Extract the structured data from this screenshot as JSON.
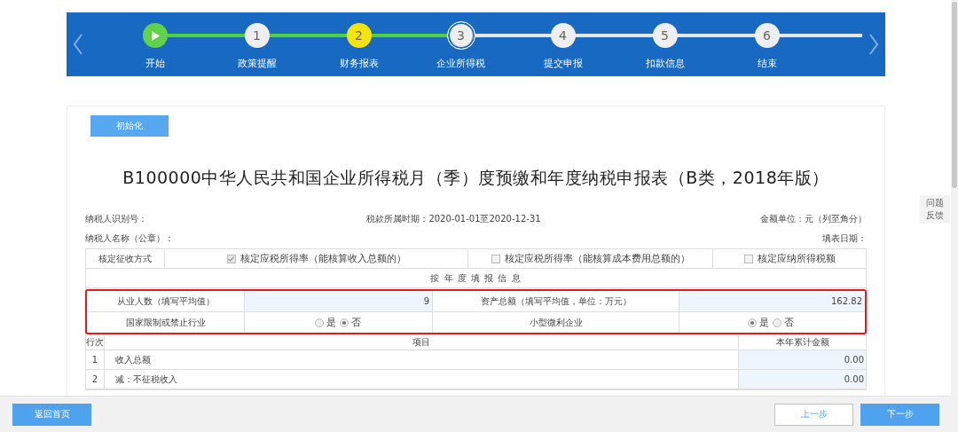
{
  "stepper": {
    "steps": [
      {
        "kind": "start",
        "label": "开始",
        "color": "#5fd24a",
        "current": false
      },
      {
        "kind": "number",
        "number": "1",
        "label": "政策提醒",
        "color": "#eeeeee",
        "reached": true,
        "current": false
      },
      {
        "kind": "number",
        "number": "2",
        "label": "财务报表",
        "color": "#f5e30f",
        "reached": true,
        "current": false
      },
      {
        "kind": "number",
        "number": "3",
        "label": "企业所得税",
        "color": "#eeeeee",
        "reached": true,
        "current": true
      },
      {
        "kind": "number",
        "number": "4",
        "label": "提交申报",
        "color": "#eeeeee",
        "reached": false,
        "current": false
      },
      {
        "kind": "number",
        "number": "5",
        "label": "扣款信息",
        "color": "#eeeeee",
        "reached": false,
        "current": false
      },
      {
        "kind": "number",
        "number": "6",
        "label": "结束",
        "color": "#eeeeee",
        "reached": false,
        "current": false
      }
    ]
  },
  "form": {
    "init_button": "初始化",
    "title": "B100000中华人民共和国企业所得税月（季）度预缴和年度纳税申报表（B类，2018年版）",
    "taxpayer_id_label": "纳税人识别号：",
    "period": "税款所属时期：2020-01-01至2020-12-31",
    "unit": "金额单位：元（列至角分）",
    "taxpayer_name_label": "纳税人名称（公章）：",
    "fill_date_label": "填表日期：",
    "method": {
      "label": "核定征收方式",
      "options": [
        {
          "text": "核定应税所得率（能核算收入总额的）",
          "checked": true
        },
        {
          "text": "核定应税所得率（能核算成本费用总额的）",
          "checked": false
        },
        {
          "text": "核定应纳所得税额",
          "checked": false
        }
      ]
    },
    "annual_heading": "按 年 度 填 报 信 息",
    "annual_rows": [
      {
        "kind": "value",
        "label": "从业人数（填写平均值）",
        "value": "9",
        "label2": "资产总额（填写平均值，单位：万元）",
        "value2": "162.82"
      },
      {
        "kind": "radio",
        "label": "国家限制或禁止行业",
        "options": [
          {
            "text": "是",
            "selected": false
          },
          {
            "text": "否",
            "selected": true
          }
        ],
        "label2": "小型微利企业",
        "options2": [
          {
            "text": "是",
            "selected": true
          },
          {
            "text": "否",
            "selected": false
          }
        ]
      }
    ],
    "items": {
      "columns": [
        "行次",
        "项目",
        "本年累计金额"
      ],
      "rows": [
        {
          "no": "1",
          "item": "收入总额",
          "amount": "0.00",
          "editable": true
        },
        {
          "no": "2",
          "item": "减：不征税收入",
          "amount": "0.00",
          "editable": true
        }
      ]
    }
  },
  "feedback": "问题反馈",
  "footer": {
    "left_buttons": [
      {
        "label": "返回首页",
        "kind": "primary"
      }
    ],
    "right_buttons": [
      {
        "label": "上一步",
        "kind": "outline"
      },
      {
        "label": "下一步",
        "kind": "primary"
      }
    ]
  }
}
